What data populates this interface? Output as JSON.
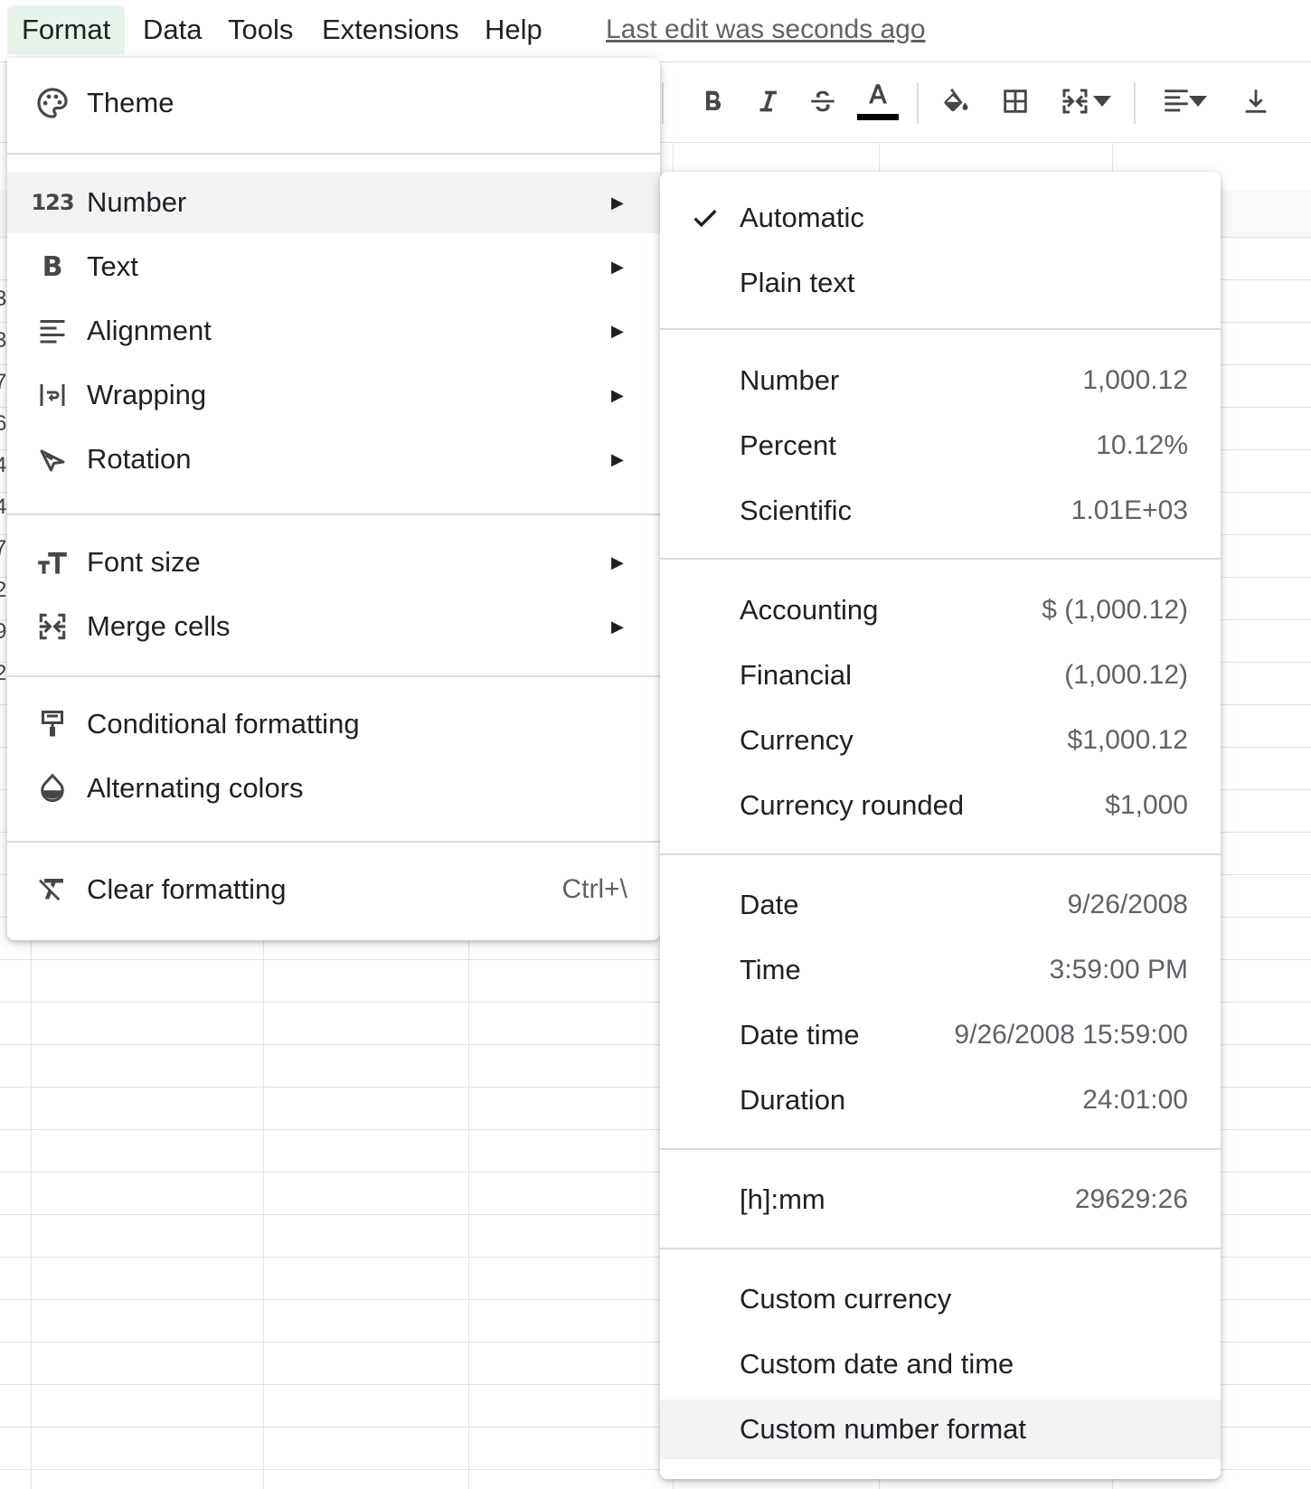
{
  "menubar": {
    "items": [
      {
        "label": "Format"
      },
      {
        "label": "Data"
      },
      {
        "label": "Tools"
      },
      {
        "label": "Extensions"
      },
      {
        "label": "Help"
      }
    ],
    "last_edit": "Last edit was seconds ago"
  },
  "grid": {
    "row_fragments": [
      "3",
      "3",
      "7",
      "6",
      "4",
      "4",
      "7",
      "2",
      "9",
      "2"
    ]
  },
  "format_menu": {
    "theme": "Theme",
    "number": "Number",
    "text": "Text",
    "alignment": "Alignment",
    "wrapping": "Wrapping",
    "rotation": "Rotation",
    "font_size": "Font size",
    "merge_cells": "Merge cells",
    "conditional_formatting": "Conditional formatting",
    "alternating_colors": "Alternating colors",
    "clear_formatting": "Clear formatting",
    "clear_formatting_shortcut": "Ctrl+\\",
    "number_icon_text": "123",
    "text_icon_text": "B",
    "highlighted_item": "Number"
  },
  "number_submenu": {
    "automatic": "Automatic",
    "plain_text": "Plain text",
    "number": {
      "label": "Number",
      "example": "1,000.12"
    },
    "percent": {
      "label": "Percent",
      "example": "10.12%"
    },
    "scientific": {
      "label": "Scientific",
      "example": "1.01E+03"
    },
    "accounting": {
      "label": "Accounting",
      "example": "$ (1,000.12)"
    },
    "financial": {
      "label": "Financial",
      "example": "(1,000.12)"
    },
    "currency": {
      "label": "Currency",
      "example": "$1,000.12"
    },
    "currency_rounded": {
      "label": "Currency rounded",
      "example": "$1,000"
    },
    "date": {
      "label": "Date",
      "example": "9/26/2008"
    },
    "time": {
      "label": "Time",
      "example": "3:59:00 PM"
    },
    "date_time": {
      "label": "Date time",
      "example": "9/26/2008 15:59:00"
    },
    "duration": {
      "label": "Duration",
      "example": "24:01:00"
    },
    "hmm": {
      "label": "[h]:mm",
      "example": "29629:26"
    },
    "custom_currency": "Custom currency",
    "custom_date_time": "Custom date and time",
    "custom_number_format": "Custom number format",
    "selected": "Automatic",
    "highlighted_item": "Custom number format"
  },
  "colors": {
    "menu_active_bg": "#e6f4ea",
    "hover_bg": "#f1f3f4",
    "text": "#202124",
    "secondary_text": "#5f6368",
    "text_color_bar": "#000000"
  }
}
